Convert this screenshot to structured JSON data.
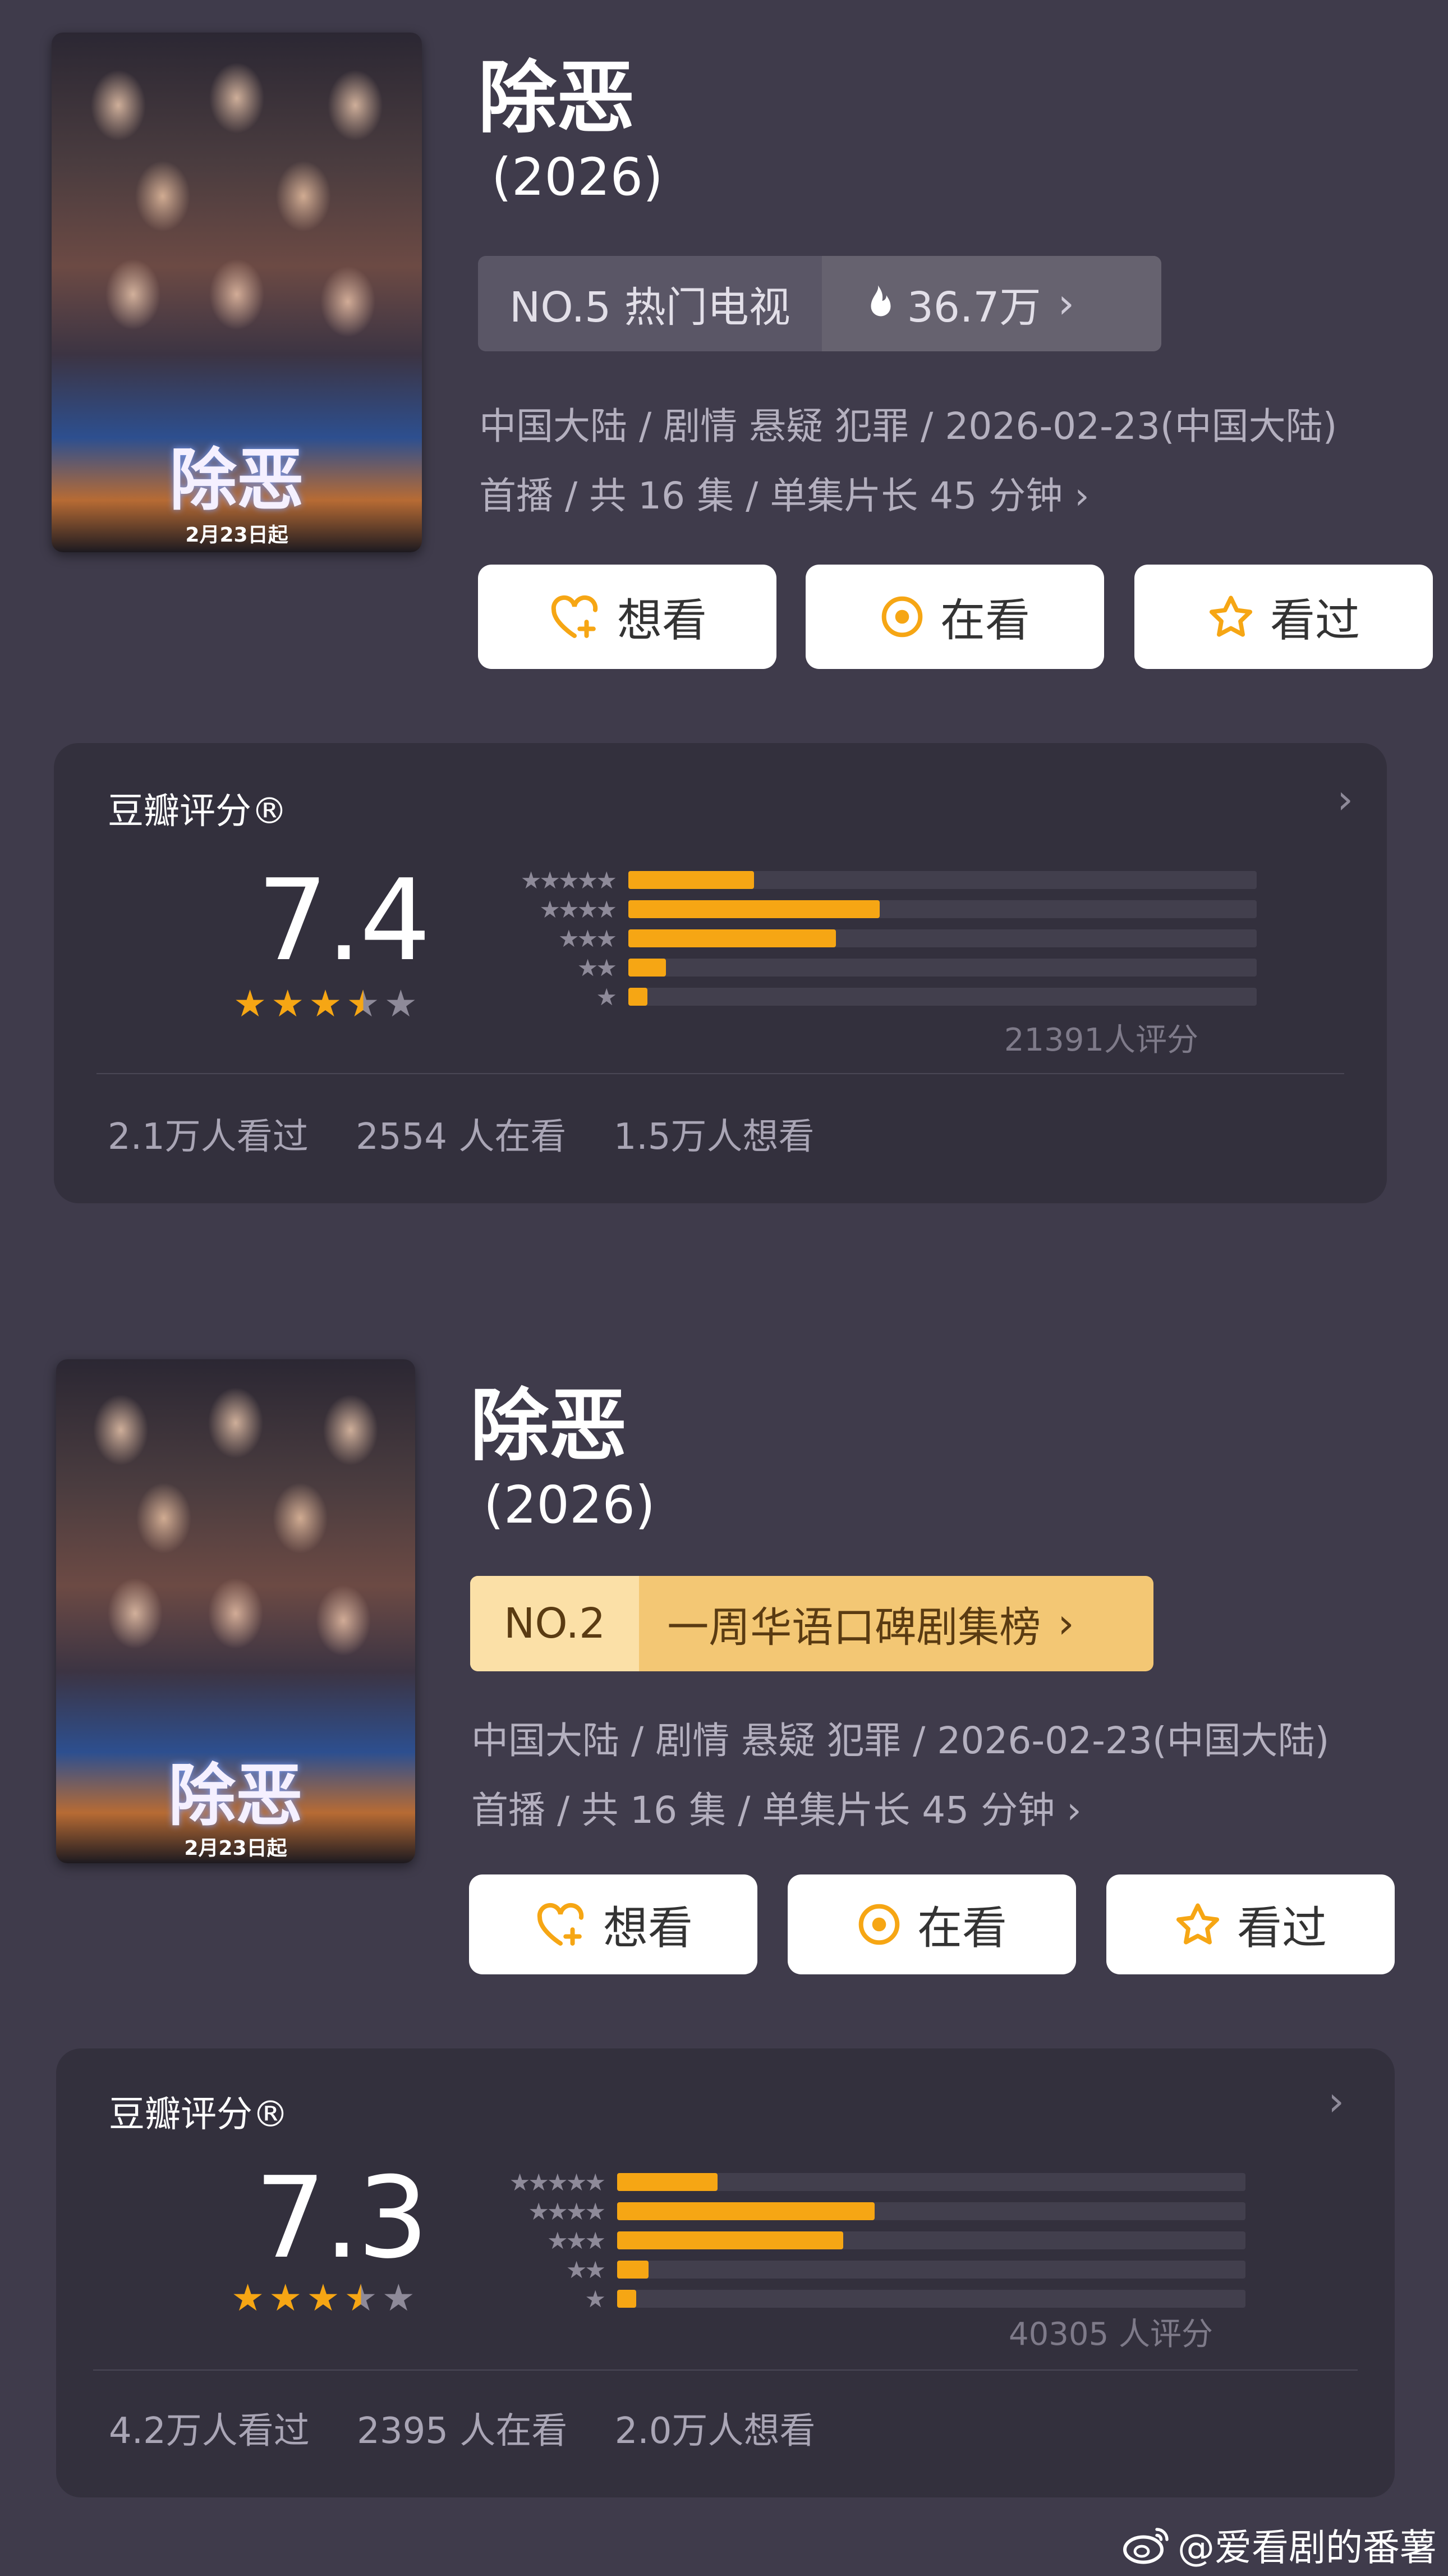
{
  "entries": [
    {
      "poster": {
        "title_art": "除恶",
        "date": "2月23日起"
      },
      "title": "除恶",
      "year": "(2026)",
      "rank": {
        "label": "NO.5 热门电视",
        "heat": "36.7万",
        "style": "gray"
      },
      "meta_line1": "中国大陆 / 剧情 悬疑 犯罪 / 2026-02-23(中国大陆)",
      "meta_line2": "首播 / 共 16 集 / 单集片长 45 分钟",
      "buttons": {
        "want": "想看",
        "watching": "在看",
        "watched": "看过"
      },
      "rating": {
        "label": "豆瓣评分®",
        "score": "7.4",
        "stars_value": 3.5,
        "distribution": [
          0.2,
          0.4,
          0.33,
          0.06,
          0.03
        ],
        "count_text": "21391人评分",
        "stats": [
          "2.1万人看过",
          "2554 人在看",
          "1.5万人想看"
        ]
      }
    },
    {
      "poster": {
        "title_art": "除恶",
        "date": "2月23日起"
      },
      "title": "除恶",
      "year": "(2026)",
      "rank": {
        "label": "NO.2",
        "heat": "一周华语口碑剧集榜",
        "style": "gold"
      },
      "meta_line1": "中国大陆 / 剧情 悬疑 犯罪 / 2026-02-23(中国大陆)",
      "meta_line2": "首播 / 共 16 集 / 单集片长 45 分钟",
      "buttons": {
        "want": "想看",
        "watching": "在看",
        "watched": "看过"
      },
      "rating": {
        "label": "豆瓣评分®",
        "score": "7.3",
        "stars_value": 3.5,
        "distribution": [
          0.16,
          0.41,
          0.36,
          0.05,
          0.03
        ],
        "count_text": "40305 人评分",
        "stats": [
          "4.2万人看过",
          "2395 人在看",
          "2.0万人想看"
        ]
      }
    }
  ],
  "watermark": "@爱看剧的番薯",
  "colors": {
    "background": "#3f3b4b",
    "card": "#33303d",
    "accent": "#f6a614",
    "button": "#ffffff"
  }
}
